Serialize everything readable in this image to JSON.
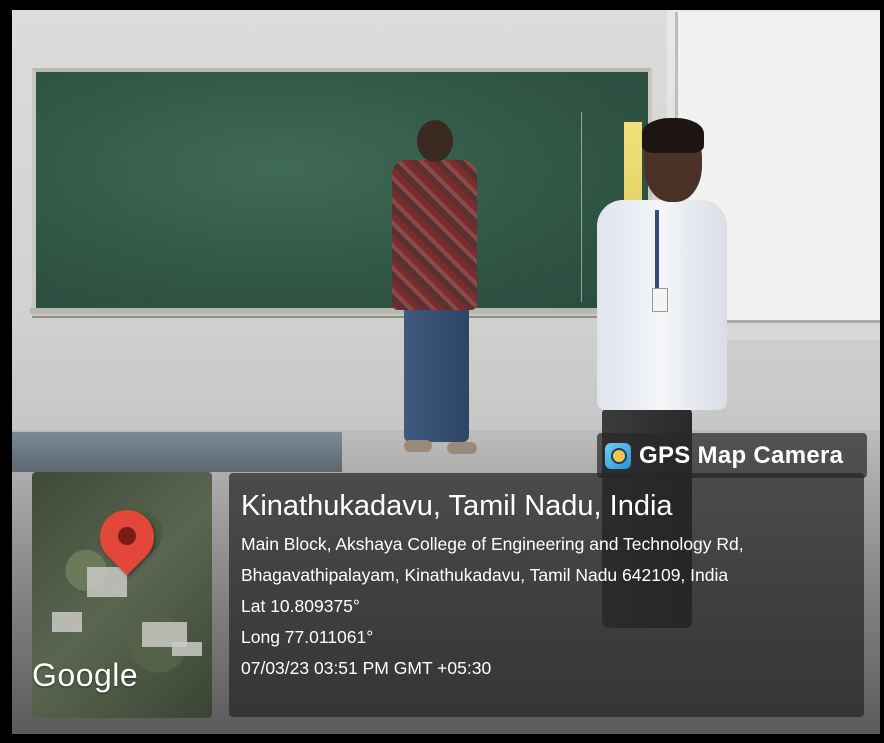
{
  "overlay": {
    "app_label": "GPS Map Camera",
    "app_icon": "gps-map-camera-icon",
    "map_logo": "Google",
    "location_title": "Kinathukadavu, Tamil Nadu, India",
    "address_line1": "Main Block, Akshaya College of Engineering and Technology Rd,",
    "address_line2": "Bhagavathipalayam, Kinathukadavu, Tamil Nadu 642109, India",
    "latitude": "Lat 10.809375°",
    "longitude": "Long 77.011061°",
    "timestamp": "07/03/23 03:51 PM GMT +05:30"
  },
  "colors": {
    "overlay_bg": "#262626",
    "text": "#ffffff",
    "map_pin": "#e2473a",
    "chalkboard": "#2f5545"
  }
}
